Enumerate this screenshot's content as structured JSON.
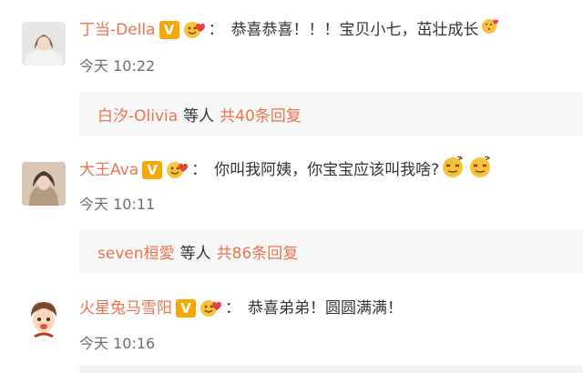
{
  "comments": [
    {
      "username": "丁当-Della",
      "vip_badge": "V",
      "text": "恭喜恭喜！！！宝贝小七，茁壮成长",
      "emoji": "kiss-heart-emoji-icon",
      "time": "今天 10:22",
      "reply": {
        "user": "白汐-Olivia",
        "mid": "等人",
        "count": "共40条回复"
      }
    },
    {
      "username": "大王Ava",
      "vip_badge": "V",
      "text": "你叫我阿姨，你宝宝应该叫我啥?",
      "emoji": "dizzy-face-emoji-icon",
      "time": "今天 10:11",
      "reply": {
        "user": "seven桓愛",
        "mid": "等人",
        "count": "共86条回复"
      }
    },
    {
      "username": "火星兔马雪阳",
      "vip_badge": "V",
      "text": "恭喜弟弟！圆圆满满！",
      "time": "今天 10:16"
    }
  ],
  "colors": {
    "username": "#eb7350",
    "badge": "#f6a800",
    "reply_bg": "#f7f7f7",
    "time": "#6e6e6e"
  }
}
